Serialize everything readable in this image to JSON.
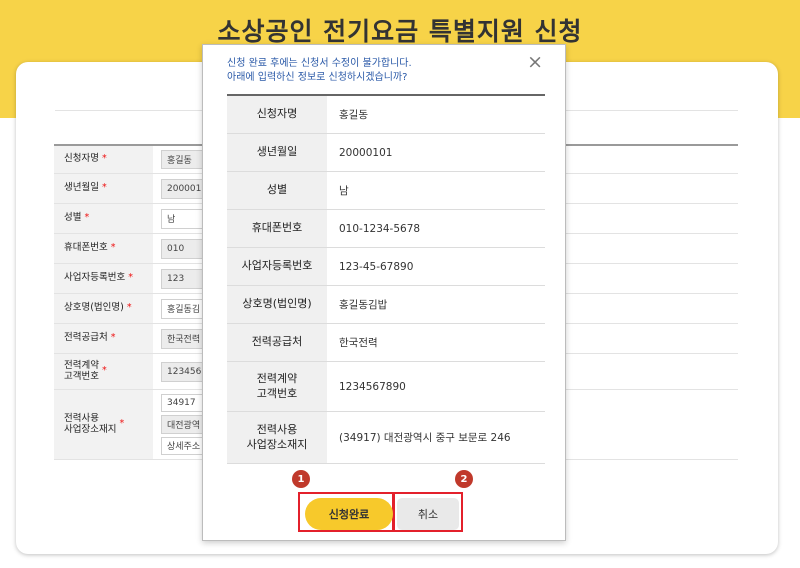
{
  "header": {
    "title": "소상공인 전기요금 특별지원 신청"
  },
  "background_form": {
    "rows": [
      {
        "label": "신청자명",
        "value": "홍길동"
      },
      {
        "label": "생년월일",
        "value": "2000010"
      },
      {
        "label": "성별",
        "value": "남"
      },
      {
        "label": "휴대폰번호",
        "value": "010"
      },
      {
        "label": "사업자등록번호",
        "value": "123"
      },
      {
        "label": "상호명(법인명)",
        "value": "홍길동김"
      },
      {
        "label": "전력공급처",
        "value": "한국전력"
      },
      {
        "label_line1": "전력계약",
        "label_line2": "고객번호",
        "value": "1234567"
      },
      {
        "label_line1": "전력사용",
        "label_line2": "사업장소재지",
        "value": "34917",
        "value2": "대전광역",
        "value3": "상세주소"
      }
    ],
    "required_mark": "*"
  },
  "modal": {
    "notice_line1": "신청 완료 후에는 신청서 수정이 불가합니다.",
    "notice_line2": "아래에 입력하신 정보로 신청하시겠습니까?",
    "close_label": "×",
    "rows": [
      {
        "label": "신청자명",
        "value": "홍길동"
      },
      {
        "label": "생년월일",
        "value": "20000101"
      },
      {
        "label": "성별",
        "value": "남"
      },
      {
        "label": "휴대폰번호",
        "value": "010-1234-5678"
      },
      {
        "label": "사업자등록번호",
        "value": "123-45-67890"
      },
      {
        "label": "상호명(법인명)",
        "value": "홍길동김밥"
      },
      {
        "label": "전력공급처",
        "value": "한국전력"
      },
      {
        "label_line1": "전력계약",
        "label_line2": "고객번호",
        "value": "1234567890"
      },
      {
        "label_line1": "전력사용",
        "label_line2": "사업장소재지",
        "value": "(34917) 대전광역시 중구 보문로 246"
      }
    ],
    "apply_label": "신청완료",
    "cancel_label": "취소",
    "marker1": "1",
    "marker2": "2"
  }
}
